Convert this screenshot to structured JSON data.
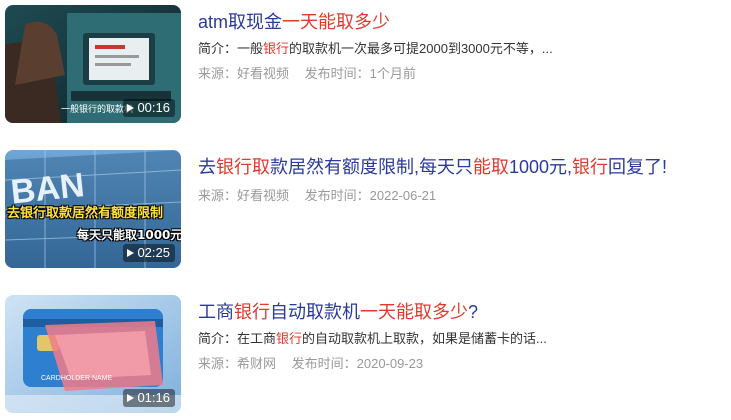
{
  "results": [
    {
      "title_parts": [
        {
          "text": "atm取现金",
          "hl": false
        },
        {
          "text": "一天能取多少",
          "hl": true
        }
      ],
      "desc_parts": [
        {
          "text": "简介：一般",
          "hl": false
        },
        {
          "text": "银行",
          "hl": true
        },
        {
          "text": "的取款机一次最多可提2000到3000元不等，...",
          "hl": false
        }
      ],
      "source": "来源：好看视频",
      "time": "发布时间：1个月前",
      "duration": "00:16",
      "thumb_caption": "一般银行的取款机"
    },
    {
      "title_parts": [
        {
          "text": "去",
          "hl": false
        },
        {
          "text": "银行取",
          "hl": true
        },
        {
          "text": "款居然有额度限制,每天只",
          "hl": false
        },
        {
          "text": "能取",
          "hl": true
        },
        {
          "text": "1000元,",
          "hl": false
        },
        {
          "text": "银行",
          "hl": true
        },
        {
          "text": "回复了!",
          "hl": false
        }
      ],
      "desc_parts": [],
      "source": "来源：好看视频",
      "time": "发布时间：2022-06-21",
      "duration": "02:25",
      "thumb_caption": "去银行取款居然有额度限制",
      "thumb_caption2": "每天只能取1000元"
    },
    {
      "title_parts": [
        {
          "text": "工商",
          "hl": false
        },
        {
          "text": "银行",
          "hl": true
        },
        {
          "text": "自动取款机",
          "hl": false
        },
        {
          "text": "一天能取多少",
          "hl": true
        },
        {
          "text": "?",
          "hl": false
        }
      ],
      "desc_parts": [
        {
          "text": "简介：在工商",
          "hl": false
        },
        {
          "text": "银行",
          "hl": true
        },
        {
          "text": "的自动取款机上取款，如果是储蓄卡的话...",
          "hl": false
        }
      ],
      "source": "来源：希财网",
      "time": "发布时间：2020-09-23",
      "duration": "01:16",
      "thumb_caption": "CARDHOLDER NAME"
    }
  ]
}
